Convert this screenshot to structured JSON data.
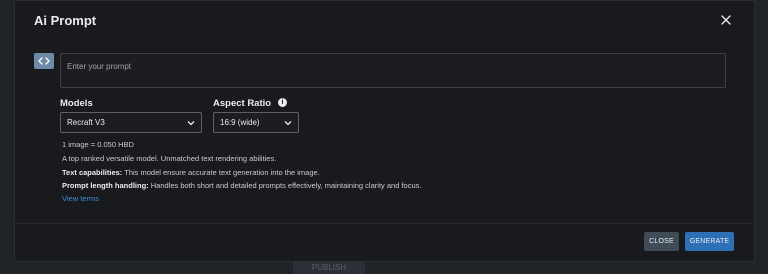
{
  "modal": {
    "title": "Ai Prompt",
    "prompt_placeholder": "Enter your prompt",
    "models_label": "Models",
    "model_selected": "Recraft V3",
    "aspect_label": "Aspect Ratio",
    "aspect_selected": "16:9 (wide)",
    "cost_text": "1 image = 0.050 HBD",
    "description": "A top ranked versatile model. Unmatched text rendering abilities.",
    "text_cap_label": "Text capabilities:",
    "text_cap_value": " This model ensure accurate text generation into the image.",
    "prompt_len_label": "Prompt length handling:",
    "prompt_len_value": " Handles both short and detailed prompts effectively, maintaining clarity and focus.",
    "view_terms": "View terms",
    "close_button": "CLOSE",
    "generate_button": "GENERATE"
  },
  "background": {
    "bottom_button": "PUBLISH"
  },
  "colors": {
    "accent": "#2e6fb6",
    "link": "#3a8fdc",
    "code_button": "#6c8aa6"
  }
}
